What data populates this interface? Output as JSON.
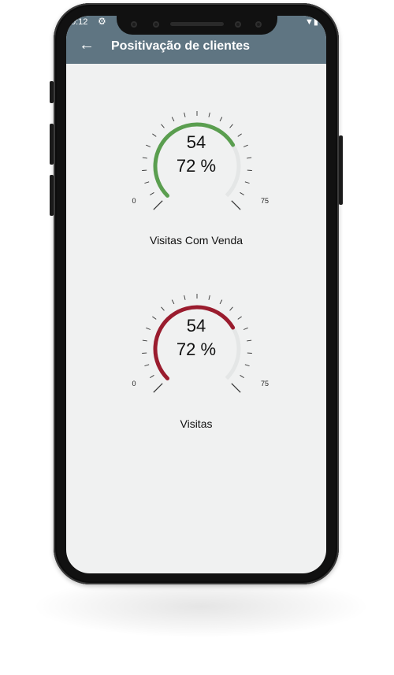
{
  "status_bar": {
    "time": "0:12",
    "gear_icon": "gear-icon",
    "right_icons": "▼▮"
  },
  "app_bar": {
    "back_icon": "back-arrow-icon",
    "back_glyph": "←",
    "title": "Positivação de clientes",
    "background": "#5f7582"
  },
  "gauges": [
    {
      "value_text": "54",
      "percent_text": "72 %",
      "min_label": "0",
      "max_label": "75",
      "label": "Visitas Com Venda",
      "color": "#5a9e4f",
      "fraction": 0.72
    },
    {
      "value_text": "54",
      "percent_text": "72 %",
      "min_label": "0",
      "max_label": "75",
      "label": "Visitas",
      "color": "#9a1c2e",
      "fraction": 0.72
    }
  ]
}
